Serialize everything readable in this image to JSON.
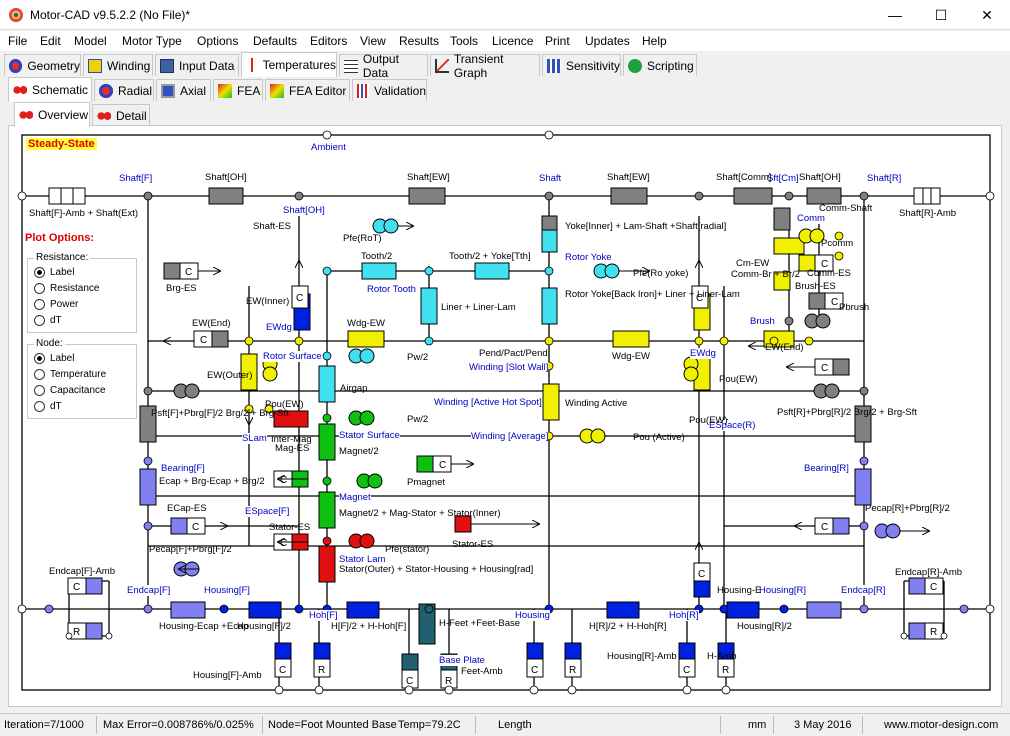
{
  "window": {
    "title": "Motor-CAD v9.5.2.2 (No File)*",
    "minimize": "—",
    "maximize": "☐",
    "close": "✕"
  },
  "menu": [
    "File",
    "Edit",
    "Model",
    "Motor Type",
    "Options",
    "Defaults",
    "Editors",
    "View",
    "Results",
    "Tools",
    "Licence",
    "Print",
    "Updates",
    "Help"
  ],
  "main_tabs": [
    "Geometry",
    "Winding",
    "Input Data",
    "Temperatures",
    "Output Data",
    "Transient Graph",
    "Sensitivity",
    "Scripting"
  ],
  "sub_tabs": [
    "Schematic",
    "Radial",
    "Axial",
    "FEA",
    "FEA Editor",
    "Validation"
  ],
  "view_tabs": [
    "Overview",
    "Detail"
  ],
  "schematic": {
    "state": "Steady-State",
    "plot_options": "Plot Options:",
    "resistance_group": {
      "title": "Resistance:",
      "options": [
        "Label",
        "Resistance",
        "Power",
        "dT"
      ],
      "selected": "Label"
    },
    "node_group": {
      "title": "Node:",
      "options": [
        "Label",
        "Temperature",
        "Capacitance",
        "dT"
      ],
      "selected": "Label"
    },
    "node_labels": [
      "Ambient",
      "Shaft[F]",
      "Shaft",
      "Shaft[R]",
      "Shaft[OH]",
      "Rotor Tooth",
      "Rotor Yoke",
      "EWdg",
      "Rotor Surface",
      "Winding [Slot Wall]",
      "Winding [Active Hot Spot]",
      "Winding [Average]",
      "EWdg",
      "SLam",
      "Stator Surface",
      "Magnet",
      "Bearing[F]",
      "Bearing[R]",
      "ESpace[F]",
      "ESpace(R)",
      "Stator Lam",
      "Endcap[F]",
      "Endcap[R]",
      "Housing[F]",
      "Housing[R]",
      "Hoh[F]",
      "Hoh[R]",
      "Housing",
      "Base Plate",
      "Comm",
      "Brush",
      "Sft[Cm]"
    ],
    "resistance_labels": [
      "Shaft[OH]",
      "Shaft[EW]",
      "Shaft[EW]",
      "Shaft[Comm]",
      "Shaft[OH]",
      "Shaft[F]-Amb + Shaft(Ext)",
      "Shaft[R]-Amb",
      "Shaft-ES",
      "Pfe(RoT)",
      "Tooth/2",
      "Tooth/2 + Yoke[Tth]",
      "Yoke[Inner] + Lam-Shaft +Shaft[radial]",
      "Pfe(Ro yoke)",
      "Rotor Yoke[Back Iron]+ Liner + Liner-Lam",
      "Liner + Liner-Lam",
      "Brg-ES",
      "EW(Inner)",
      "EW(End)",
      "Wdg-EW",
      "Pw/2",
      "Pend/Pact/Pend",
      "Wdg-EW",
      "EW(End)",
      "EW(Outer)",
      "Airgap",
      "Pou(EW)",
      "Pw/2",
      "Inter-Mag",
      "Winding Active",
      "Pou (Active)",
      "Magnet/2",
      "Mag-ES",
      "Pmagnet",
      "Magnet/2 + Mag-Stator + Stator(Inner)",
      "Stator-ES",
      "Stator(Outer) + Stator-Housing + Housing[rad]",
      "Pfe(stator)",
      "Stator-ES",
      "Ecap + Brg-Ecap + Brg/2",
      "ECap-ES",
      "Pecap[F]+Pbrg[F]/2",
      "Pecap[R]+Pbrg[R]/2",
      "Psft[F]+Pbrg[F]/2 Brg/2 + Brg-Sft",
      "Psft[R]+Pbrg[R]/2 Brg/2 + Brg-Sft",
      "Endcap[F]-Amb",
      "Endcap[R]-Amb",
      "Housing-Ecap +Ecap",
      "Housing[F]/2",
      "H[F]/2 + H-Hoh[F]",
      "H-Feet +Feet-Base",
      "H[R]/2 + H-Hoh[R]",
      "Housing[R]/2",
      "Housing-E",
      "Housing[F]-Amb",
      "Housing[R]-Amb",
      "H-Amb",
      "Feet-Amb",
      "Comm-Shaft",
      "Pcomm",
      "Cm-EW",
      "Comm-Br + Br/2",
      "Comm-ES",
      "Brush-ES",
      "Pbrush",
      "Pou(EW)",
      "Pou(EW)"
    ]
  },
  "status": {
    "iteration": "Iteration=7/1000",
    "max_error": "Max Error=0.008786%/0.025%",
    "node": "Node=Foot Mounted Base",
    "temp": "Temp=79.2C",
    "length": "Length",
    "unit": "mm",
    "date": "3 May 2016",
    "website": "www.motor-design.com"
  },
  "colors": {
    "resistance": "#f0f000",
    "cyan": "#40e0f0",
    "green": "#10c010",
    "red": "#e01010",
    "blue": "#0020e0",
    "gray": "#808080",
    "lilac": "#8080f0",
    "label_blue": "#0000c0",
    "plot_red": "#e00000"
  }
}
